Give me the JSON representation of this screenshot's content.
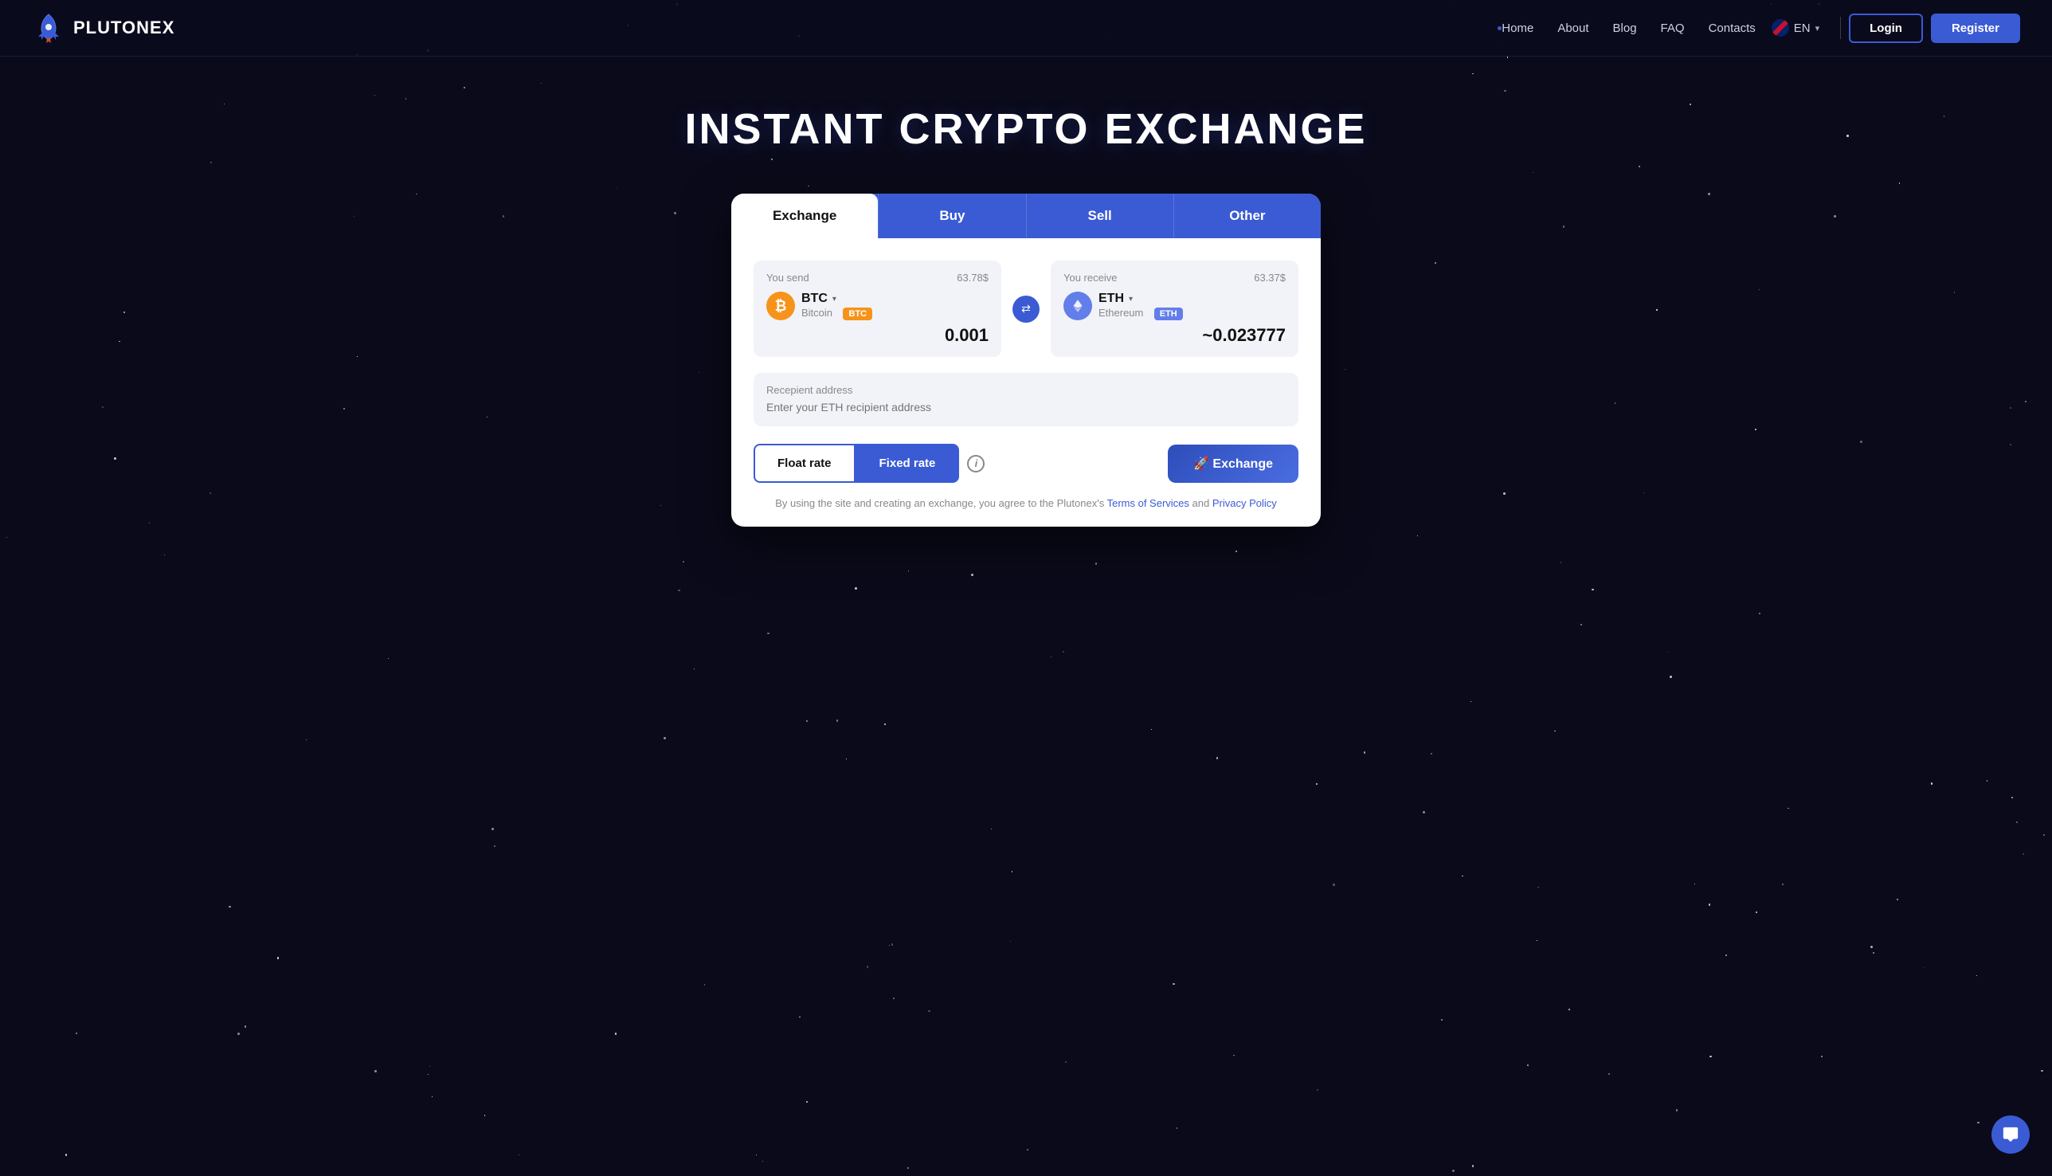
{
  "site": {
    "name": "PLUTONEX"
  },
  "nav": {
    "links": [
      {
        "label": "Home",
        "id": "home"
      },
      {
        "label": "About",
        "id": "about"
      },
      {
        "label": "Blog",
        "id": "blog"
      },
      {
        "label": "FAQ",
        "id": "faq"
      },
      {
        "label": "Contacts",
        "id": "contacts"
      }
    ],
    "language": "EN",
    "login_label": "Login",
    "register_label": "Register"
  },
  "hero": {
    "title": "INSTANT CRYPTO EXCHANGE"
  },
  "exchange_card": {
    "tabs": [
      {
        "label": "Exchange",
        "id": "exchange",
        "active": true
      },
      {
        "label": "Buy",
        "id": "buy"
      },
      {
        "label": "Sell",
        "id": "sell"
      },
      {
        "label": "Other",
        "id": "other"
      }
    ],
    "send": {
      "label": "You send",
      "usd": "63.78$",
      "currency_symbol": "BTC",
      "currency_name": "Bitcoin",
      "badge": "BTC",
      "amount": "0.001"
    },
    "receive": {
      "label": "You receive",
      "usd": "63.37$",
      "currency_symbol": "ETH",
      "currency_name": "Ethereum",
      "badge": "ETH",
      "amount": "~0.023777"
    },
    "recipient": {
      "label": "Recepient address",
      "placeholder": "Enter your ETH recipient address"
    },
    "rate_buttons": {
      "float_label": "Float rate",
      "fixed_label": "Fixed rate"
    },
    "exchange_button": "🚀 Exchange",
    "terms_text": "By using the site and creating an exchange, you agree to the Plutonex's",
    "terms_of_service": "Terms of Services",
    "and": "and",
    "privacy_policy": "Privacy Policy"
  }
}
